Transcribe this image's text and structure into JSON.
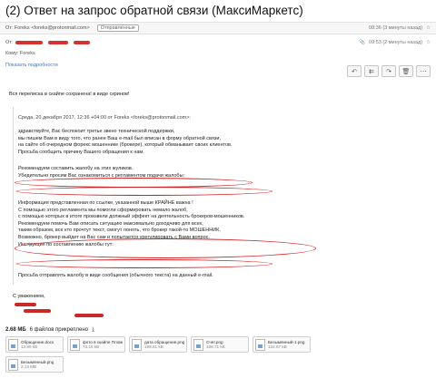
{
  "title": "(2) Ответ на запрос обратной связи (МаксиМаркетс)",
  "collapsed": {
    "from": "От: Foreks <foreks@protonmail.com>",
    "tag": "Отправленные",
    "time": "08:36 (3 минуты назад)"
  },
  "expanded": {
    "from_label": "От:",
    "time": "09:53 (2 минуты назад)",
    "to": "Кому: Foreks",
    "details": "Показать подробности"
  },
  "body": {
    "intro": [
      "Вся переписка в скайпе сохранена! в виде скринов!"
    ],
    "quote_header": "Среда, 20 декабря 2017, 12:36 +04:00 от Foreks <foreks@protonmail.com>:",
    "p1": [
      "здравствуйте, Вас беспокоит третье звено технической поддержки,",
      "мы пишем Вам в виду того, что ранее Ваш e-mail был вписан в форму обратной связи,",
      "на сайте об очередном форекс мошеннике (брокере), который обманывает своих клиентов.",
      "Просьба сообщить причину Вашего обращения к нам."
    ],
    "p2": [
      "Рекомендуем составить жалобу на этих жуликов.",
      "Убедительно просим Вас ознакомиться с регламентом подачи жалобы:"
    ],
    "p3": [
      "Информация представленная по ссылке, указанной выше КРАЙНЕ важна !",
      "С помощью этого регламента мы помогли сформировать немало жалоб,",
      "с помощью которых в итоге произвели должный эффект на деятельность брокеров-мошенников.",
      "Рекомендуем помочь Вам описать ситуацию максимально доходчиво для всех,",
      "таким образом, все кто прочтут текст, смогут понять, что брокер такой-то МОШЕННИК.",
      "Возможно, брокер выйдет на Вас сам и попытается урегулировать с Вами вопрос.",
      "Инструкция по составлению жалобы тут:"
    ],
    "p4": [
      "Просьба отправлять жалобу в виде сообщения (обычного текста) на данный e-mail."
    ],
    "sign": [
      "С уважением,"
    ]
  },
  "attachments": {
    "size": "2.68 МБ",
    "count": "6 файлов прикреплено",
    "files": [
      {
        "name": "Обращение.docx",
        "size": "13.99 kB"
      },
      {
        "name": "фото в скайпе Пломоа.jpg",
        "size": "73.16 kB"
      },
      {
        "name": "дата обращение.png",
        "size": "188.61 kB"
      },
      {
        "name": "Счет.png",
        "size": "188.71 kB"
      },
      {
        "name": "Безымянный-1.png",
        "size": "134.67 kB"
      },
      {
        "name": "Безымянный.png",
        "size": "2.13 MB"
      }
    ]
  },
  "colors": {
    "annotation": "#d42020",
    "link": "#4a7ab5"
  }
}
